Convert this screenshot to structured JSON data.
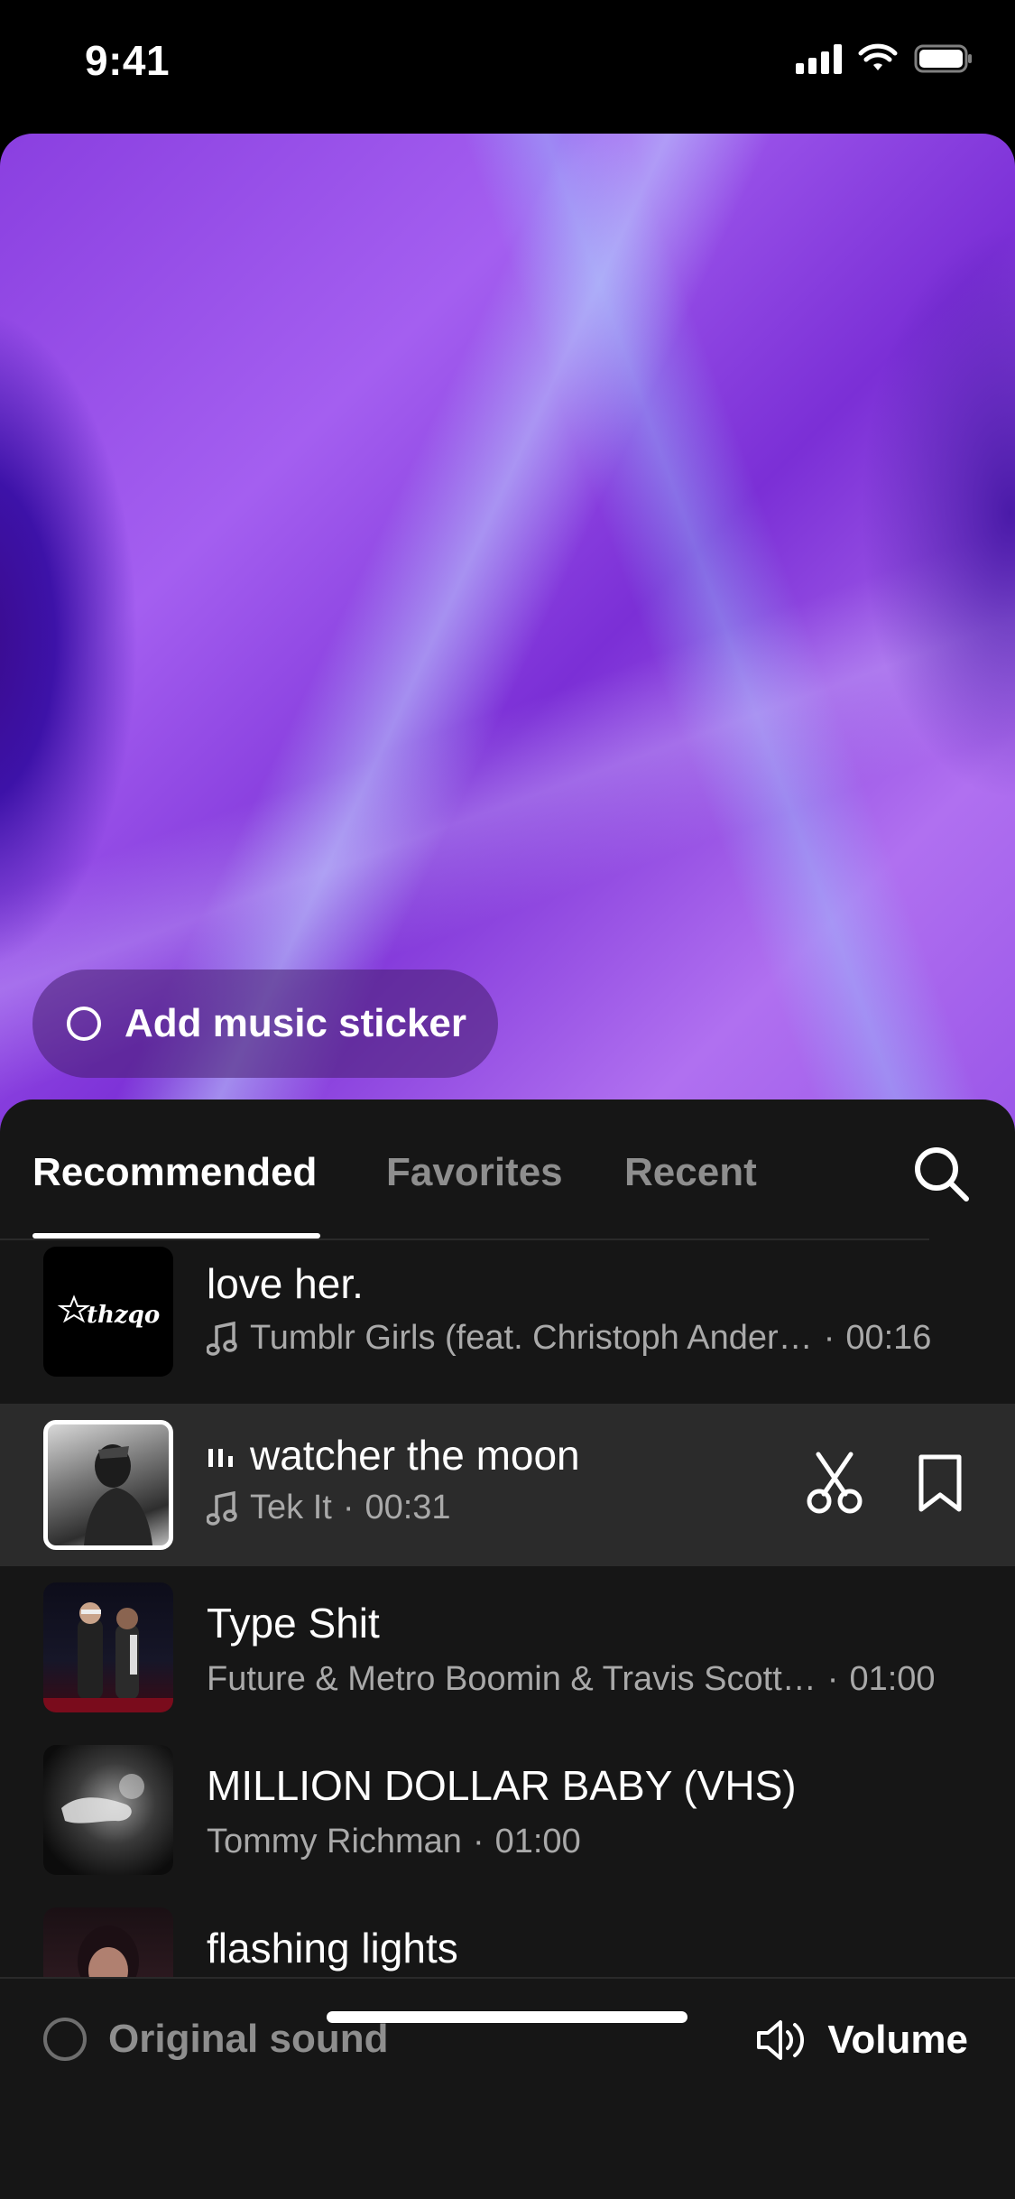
{
  "status_bar": {
    "time": "9:41"
  },
  "preview": {
    "sticker_label": "Add music sticker"
  },
  "tabs": [
    {
      "label": "Recommended",
      "active": true
    },
    {
      "label": "Favorites",
      "active": false
    },
    {
      "label": "Recent",
      "active": false
    }
  ],
  "icons": {
    "search": "search-icon",
    "music_note": "music-note-icon",
    "pause": "pause-icon",
    "scissors": "scissors-icon",
    "bookmark": "bookmark-icon",
    "volume": "speaker-icon"
  },
  "songs": [
    {
      "title": "love her.",
      "artist": "Tumblr Girls (feat. Christoph Ander…",
      "duration": "00:16",
      "has_note": true
    },
    {
      "title": "watcher the moon",
      "artist": "Tek It",
      "duration": "00:31",
      "has_note": true,
      "playing": true
    },
    {
      "title": "Type Shit",
      "artist": "Future & Metro Boomin & Travis Scott…",
      "duration": "01:00",
      "has_note": false
    },
    {
      "title": "MILLION DOLLAR BABY (VHS)",
      "artist": "Tommy Richman",
      "duration": "01:00",
      "has_note": false
    },
    {
      "title": "flashing lights",
      "artist": "",
      "duration": "",
      "has_note": false
    }
  ],
  "bottom": {
    "original_sound": "Original sound",
    "volume": "Volume"
  },
  "colors": {
    "background": "#000000",
    "sheet": "#161616",
    "selected_row": "#2b2b2b",
    "muted_text": "#8e8e8e"
  }
}
